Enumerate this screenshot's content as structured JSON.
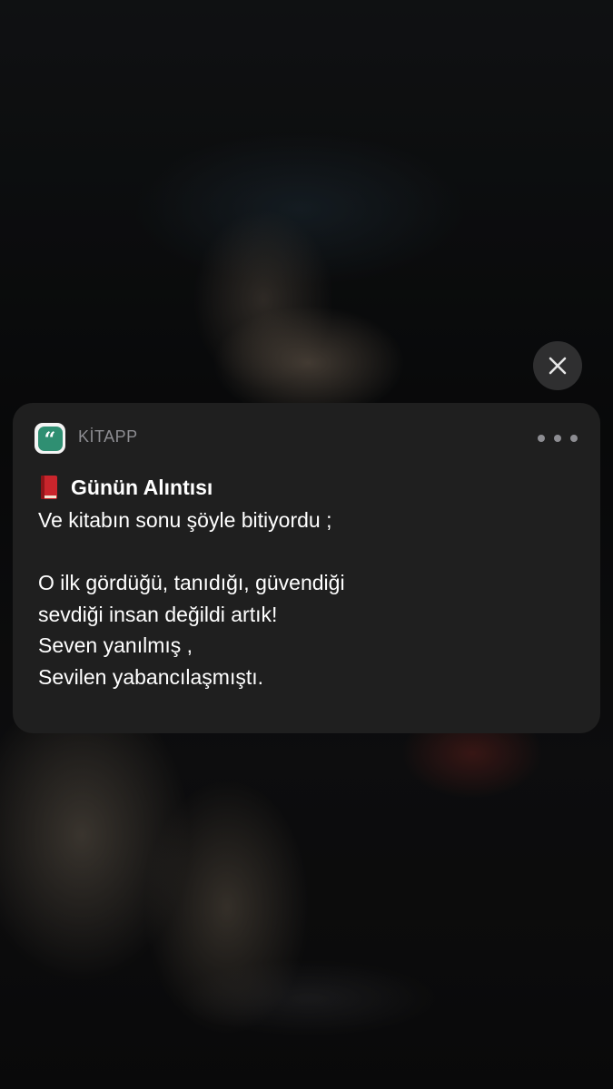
{
  "close_button": {
    "icon": "close-icon"
  },
  "notification": {
    "app_icon": "quote-icon",
    "app_icon_glyph": "“",
    "app_name": "KİTAPP",
    "more_icon": "more-icon",
    "title_icon": "closed-book-icon",
    "title": "Günün Alıntısı",
    "lines": [
      "Ve kitabın sonu şöyle bitiyordu ;",
      "",
      "O ilk gördüğü, tanıdığı, güvendiği",
      "sevdiği insan değildi artık!",
      "Seven yanılmış ,",
      "Sevilen yabancılaşmıştı."
    ]
  },
  "colors": {
    "card_background": "#1f1f1f",
    "app_icon_green": "#2f8f72",
    "secondary_text": "#8d8d92",
    "book_red": "#c9252c"
  }
}
